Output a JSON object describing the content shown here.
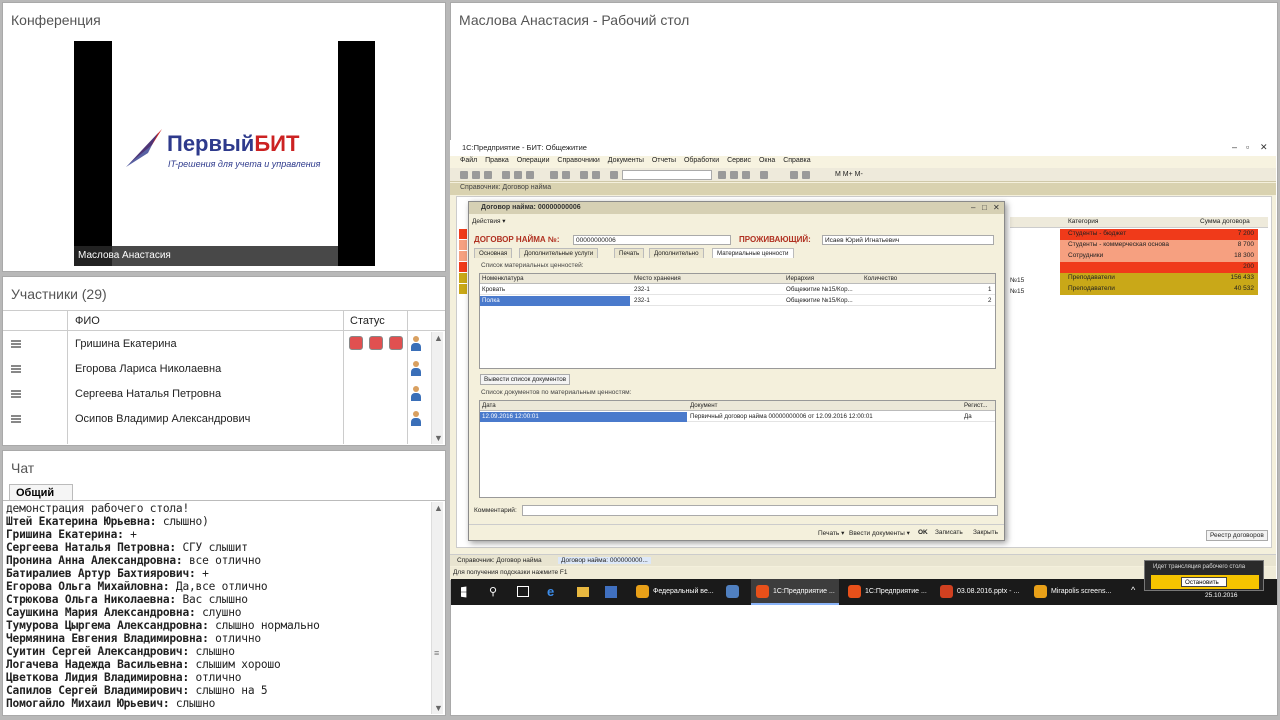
{
  "conference": {
    "title": "Конференция",
    "logo_first": "Первый",
    "logo_second": "БИТ",
    "logo_tagline": "IT-решения для учета и управления",
    "presenter": "Маслова Анастасия"
  },
  "participants": {
    "title": "Участники (29)",
    "col_name": "ФИО",
    "col_status": "Статус",
    "rows": [
      {
        "name": "Гришина Екатерина"
      },
      {
        "name": "Егорова Лариса Николаевна"
      },
      {
        "name": "Сергеева  Наталья   Петровна"
      },
      {
        "name": "Осипов Владимир Александрович"
      }
    ]
  },
  "chat": {
    "title": "Чат",
    "tab": "Общий",
    "messages": [
      {
        "author": "",
        "text": "демонстрация рабочего стола!"
      },
      {
        "author": "Штей Екатерина Юрьевна:",
        "text": " слышно)"
      },
      {
        "author": "Гришина Екатерина:",
        "text": " +"
      },
      {
        "author": "Сергеева  Наталья   Петровна:",
        "text": " СГУ слышит"
      },
      {
        "author": "Пронина Анна Александровна:",
        "text": " все отлично"
      },
      {
        "author": "Батиралиев Артур  Бахтиярович:",
        "text": " +"
      },
      {
        "author": "Егорова Ольга Михайловна:",
        "text": " Да,все отлично"
      },
      {
        "author": "Стрюкова Ольга Николаевна:",
        "text": " Вас слышно"
      },
      {
        "author": "Саушкина Мария Александровна:",
        "text": " слушно"
      },
      {
        "author": "Тумурова Цыргема  Александровна:",
        "text": " слышно нормально"
      },
      {
        "author": "Чермянина  Евгения   Владимировна:",
        "text": " отлично"
      },
      {
        "author": "Суитин Сергей Александрович:",
        "text": " слышно"
      },
      {
        "author": "Логачева Надежда Васильевна:",
        "text": " слышим хорошо"
      },
      {
        "author": "Цветкова Лидия Владимировна:",
        "text": " отлично"
      },
      {
        "author": "Сапилов Сергей Владимирович:",
        "text": " слышно на 5"
      },
      {
        "author": "Помогайло Михаил Юрьевич:",
        "text": " слышно"
      }
    ]
  },
  "desktop": {
    "title": "Маслова Анастасия - Рабочий стол"
  },
  "app1c": {
    "title": "1С:Предприятие - БИТ: Общежитие",
    "menu": "Файл Правка Операции Справочники Документы Отчеты Обработки Сервис Окна Справка",
    "toolbar_extra": "М  М+  М-",
    "subwindow": "Справочник: Договор найма",
    "bg_col_category": "Категория",
    "bg_col_sum": "Сумма договора",
    "bg_rows": [
      {
        "cat": "Студенты - бюджет",
        "sum": "7 200",
        "color": "#f03a1a"
      },
      {
        "cat": "Студенты - коммерческая основа",
        "sum": "8 700",
        "color": "#f6a080"
      },
      {
        "cat": "Сотрудники",
        "sum": "18 300",
        "color": "#f6a080"
      },
      {
        "cat": "",
        "sum": "200",
        "color": "#f03a1a"
      },
      {
        "cat": "Преподаватели",
        "sum": "156 433",
        "color": "#c9a818"
      },
      {
        "cat": "Преподаватели",
        "sum": "40 532",
        "color": "#c9a818"
      }
    ],
    "bg_left_labels": [
      "№15",
      "№15"
    ],
    "registry_btn": "Реестр договоров",
    "taskbar_items": [
      "Справочник: Договор найма",
      "Договор найма: 000000000..."
    ],
    "status": "Для получения подсказки нажмите F1"
  },
  "dialog": {
    "title": "Договор найма: 00000000006",
    "actions": "Действия ▾",
    "header_label": "ДОГОВОР НАЙМА №:",
    "number": "00000000006",
    "resident_label": "ПРОЖИВАЮЩИЙ:",
    "resident": "Исаев Юрий Игнатьевич",
    "tabs": [
      "Основная",
      "Дополнительные услуги",
      "Печать",
      "Дополнительно",
      "Материальные ценности"
    ],
    "section1": "Список материальных ценностей:",
    "grid1_cols": [
      "Номенклатура",
      "Место хранения",
      "Иерархия",
      "Количество"
    ],
    "grid1_rows": [
      {
        "nom": "Кровать",
        "place": "232-1",
        "hier": "Общежитие №15/Кор...",
        "qty": "1"
      },
      {
        "nom": "Полка",
        "place": "232-1",
        "hier": "Общежитие №15/Кор...",
        "qty": "2"
      }
    ],
    "btn_docs": "Вывести список документов",
    "section2": "Список документов по материальным ценностям:",
    "grid2_cols": [
      "Дата",
      "Документ",
      "Регист..."
    ],
    "grid2_rows": [
      {
        "date": "12.09.2016 12:00:01",
        "doc": "Первичный договор найма 00000000006 от 12.09.2016 12:00:01",
        "reg": "Да"
      }
    ],
    "comment_label": "Комментарий:",
    "foot": [
      "Печать ▾",
      "Ввести документы ▾",
      "OK",
      "Записать",
      "Закрыть"
    ]
  },
  "taskbar": {
    "items": [
      {
        "label": "Федеральный ве...",
        "color": "#e8a018"
      },
      {
        "label": "",
        "color": "#5080c0"
      },
      {
        "label": "1С:Предприятие ...",
        "color": "#e8501a"
      },
      {
        "label": "1С:Предприятие ...",
        "color": "#e8501a"
      },
      {
        "label": "03.08.2016.pptx - ...",
        "color": "#d04020"
      },
      {
        "label": "Mirapolis screens...",
        "color": "#e8a018"
      }
    ],
    "date": "25.10.2016"
  },
  "notify": {
    "text": "Идет трансляция рабочего стола",
    "button": "Остановить"
  }
}
